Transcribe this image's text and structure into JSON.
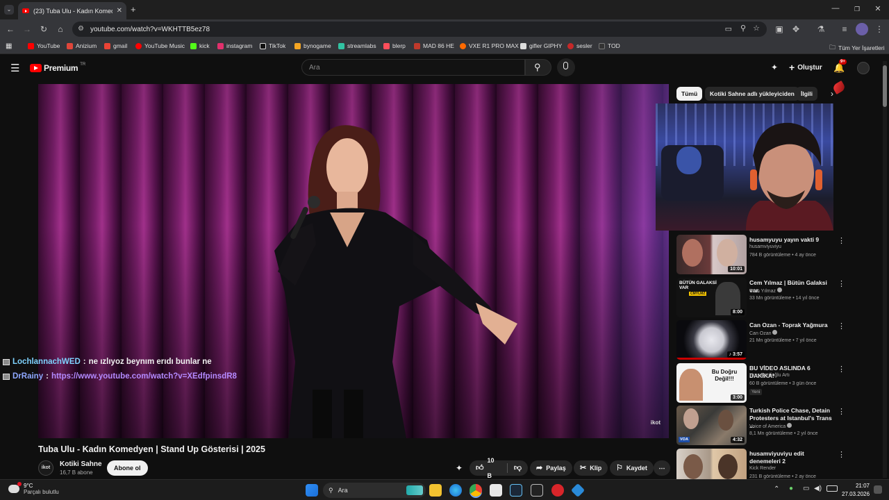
{
  "browser": {
    "tab_title": "(23) Tuba Ulu - Kadın Komedye",
    "url": "youtube.com/watch?v=WKHTTB5ez78",
    "bookmarks": [
      {
        "label": "YouTube",
        "color": "#ff0000"
      },
      {
        "label": "Anizium",
        "color": "#e0463a"
      },
      {
        "label": "gmail",
        "color": "#ea4335"
      },
      {
        "label": "YouTube Music",
        "color": "#ff0000"
      },
      {
        "label": "kick",
        "color": "#53fc18"
      },
      {
        "label": "instagram",
        "color": "#e1306c"
      },
      {
        "label": "TikTok",
        "color": "#ffffff"
      },
      {
        "label": "bynogame",
        "color": "#f5a623"
      },
      {
        "label": "streamlabs",
        "color": "#31c3a2"
      },
      {
        "label": "blerp",
        "color": "#ff4e5b"
      },
      {
        "label": "MAD 86 HE",
        "color": "#c0392b"
      },
      {
        "label": "VXE R1 PRO MAX",
        "color": "#ff6a00"
      },
      {
        "label": "gifler GIPHY",
        "color": "#dddddd"
      },
      {
        "label": "sesler",
        "color": "#c62828"
      },
      {
        "label": "TOD",
        "color": "#333333"
      }
    ],
    "all_bookmarks": "Tüm Yer İşaretleri"
  },
  "youtube": {
    "logo_text": "Premium",
    "logo_region": "TR",
    "search_placeholder": "Ara",
    "create_label": "Oluştur",
    "notif_count": "9+"
  },
  "video": {
    "title": "Tuba Ulu - Kadın Komedyen | Stand Up Gösterisi | 2025",
    "channel": "Kotiki Sahne",
    "channel_avatar_text": "ikot",
    "watermark": "ikot",
    "subscribers": "16,7 B abone",
    "subscribe_label": "Abone ol",
    "likes": "10 B",
    "share_label": "Paylaş",
    "clip_label": "Klip",
    "save_label": "Kaydet"
  },
  "chat": [
    {
      "user": "LochlannachWED",
      "message": "ne ızlıyoz beynım erıdı bunlar ne",
      "is_link": false
    },
    {
      "user": "DrRainy",
      "message": "https://www.youtube.com/watch?v=XEdfpinsdR8",
      "is_link": true
    }
  ],
  "chips": [
    "Tümü",
    "Kotiki Sahne adlı yükleyiciden",
    "İlgili"
  ],
  "recommendations": [
    {
      "title": "husamyuyu yayın vakti 9",
      "channel": "husamviyuviyu",
      "verified": false,
      "meta": "784 B görüntüleme • 4 ay önce",
      "duration": "10:01",
      "badge": ""
    },
    {
      "title": "Cem Yılmaz | Bütün Galaksi var.",
      "channel": "Cem Yılmaz",
      "verified": true,
      "meta": "33 Mn görüntüleme • 14 yıl önce",
      "duration": "8:00",
      "badge": "",
      "thumb_text": "BÜTÜN GALAKSİ VAR",
      "thumb_subtext": "CMYLMZ"
    },
    {
      "title": "Can Ozan - Toprak Yağmura",
      "channel": "Can Ozan",
      "verified": true,
      "meta": "21 Mn görüntüleme • 7 yıl önce",
      "duration": "3:57",
      "badge": ""
    },
    {
      "title": "BU VİDEO ASLINDA 6 DAKİKA!",
      "channel": "Uras Benlioğlu Artı",
      "verified": false,
      "meta": "60 B görüntüleme • 3 gün önce",
      "duration": "3:00",
      "badge": "Yeni",
      "thumb_text": "Bu Doğru Değil!!!"
    },
    {
      "title": "Turkish Police Chase, Detain Protesters at Istanbul's Trans ...",
      "channel": "Voice of America",
      "verified": true,
      "meta": "8,1 Mn görüntüleme • 2 yıl önce",
      "duration": "4:32",
      "badge": "",
      "thumb_text": "VOA"
    },
    {
      "title": "husamviyuviyu edit denemeleri 2",
      "channel": "Kick Render",
      "verified": false,
      "meta": "231 B görüntüleme • 2 ay önce",
      "duration": "",
      "badge": ""
    }
  ],
  "taskbar": {
    "weather_temp": "9°C",
    "weather_desc": "Parçalı bulutlu",
    "search_label": "Ara",
    "time": "21:07",
    "date": "27.03.2026"
  }
}
